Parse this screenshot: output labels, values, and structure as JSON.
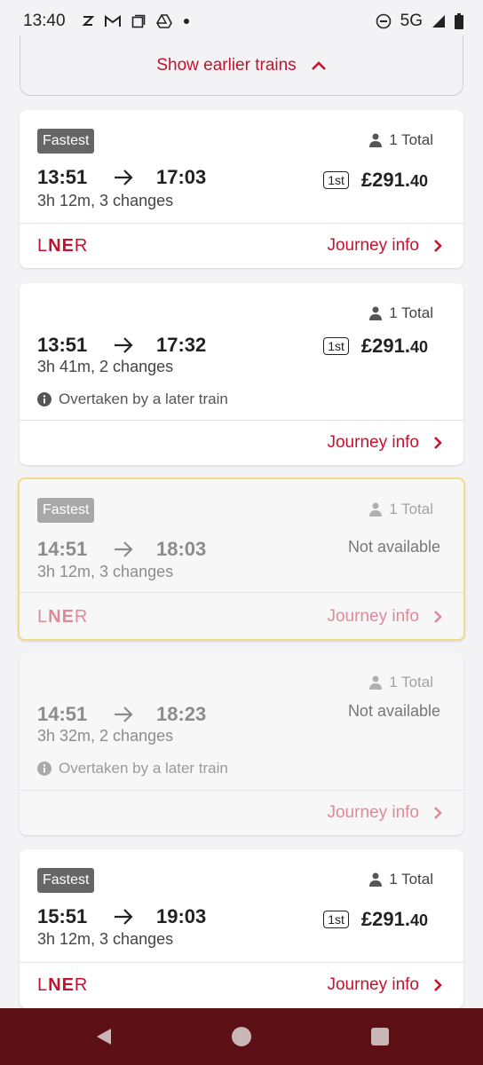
{
  "status_bar": {
    "time": "13:40",
    "left_icons": [
      "zeta-icon",
      "gmail-icon",
      "square-icon",
      "drive-icon",
      "dot-icon"
    ],
    "network": "5G"
  },
  "earlier": {
    "label": "Show earlier trains"
  },
  "cards": [
    {
      "badge": "Fastest",
      "passengers": "1 Total",
      "depart": "13:51",
      "arrive": "17:03",
      "duration": "3h 12m, 3 changes",
      "fare_class": "1st",
      "price_pounds": "£291.",
      "price_pence": "40",
      "operator": "LNER",
      "journey_info": "Journey info"
    },
    {
      "passengers": "1 Total",
      "depart": "13:51",
      "arrive": "17:32",
      "duration": "3h 41m, 2 changes",
      "fare_class": "1st",
      "price_pounds": "£291.",
      "price_pence": "40",
      "note": "Overtaken by a later train",
      "journey_info": "Journey info"
    },
    {
      "badge": "Fastest",
      "passengers": "1 Total",
      "depart": "14:51",
      "arrive": "18:03",
      "duration": "3h 12m, 3 changes",
      "availability": "Not available",
      "operator": "LNER",
      "journey_info": "Journey info"
    },
    {
      "passengers": "1 Total",
      "depart": "14:51",
      "arrive": "18:23",
      "duration": "3h 32m, 2 changes",
      "availability": "Not available",
      "note": "Overtaken by a later train",
      "journey_info": "Journey info"
    },
    {
      "badge": "Fastest",
      "passengers": "1 Total",
      "depart": "15:51",
      "arrive": "19:03",
      "duration": "3h 12m, 3 changes",
      "fare_class": "1st",
      "price_pounds": "£291.",
      "price_pence": "40",
      "operator": "LNER",
      "journey_info": "Journey info"
    }
  ],
  "colors": {
    "brand": "#c4122f",
    "nav_bar": "#5c0f15",
    "selected_border": "#f2dc8c"
  }
}
